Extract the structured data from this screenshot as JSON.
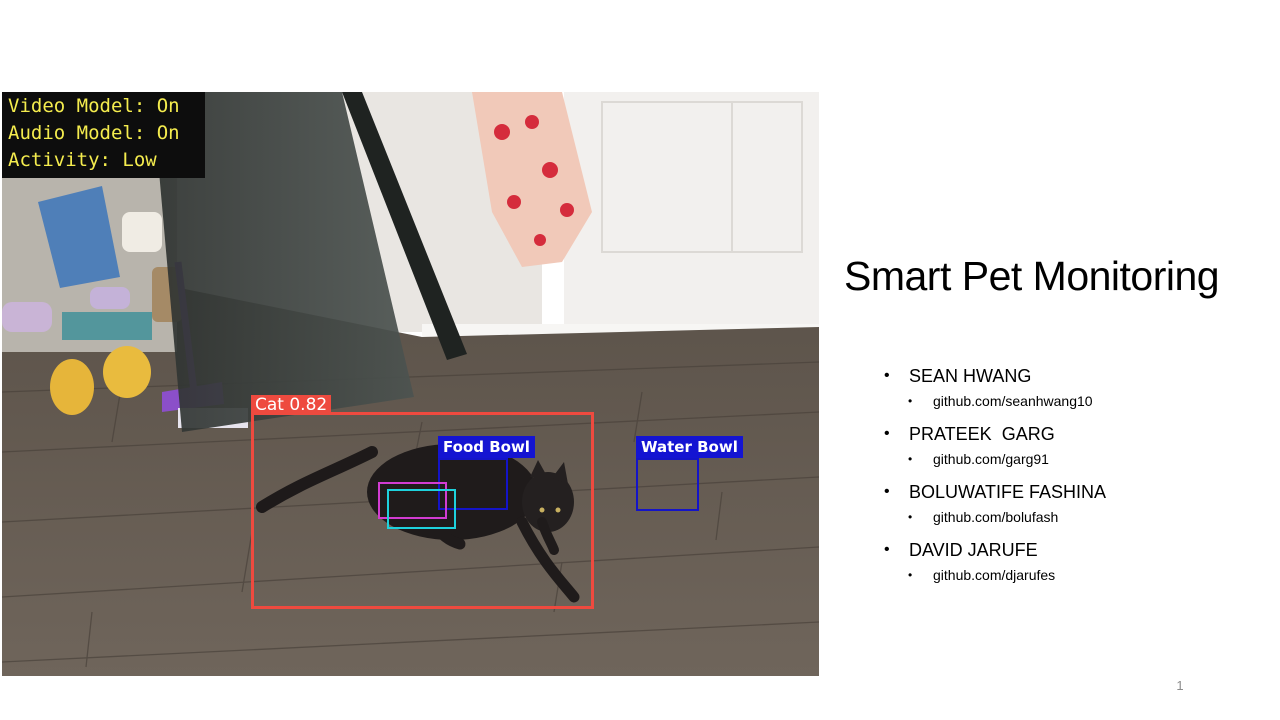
{
  "slide": {
    "title": "Smart Pet Monitoring",
    "page_number": "1",
    "team": [
      {
        "name": "SEAN HWANG",
        "link": "github.com/seanhwang10"
      },
      {
        "name": "PRATEEK  GARG",
        "link": "github.com/garg91"
      },
      {
        "name": "BOLUWATIFE FASHINA",
        "link": "github.com/bolufash"
      },
      {
        "name": "DAVID JARUFE",
        "link": "github.com/djarufes"
      }
    ]
  },
  "video": {
    "status_lines": [
      "Video Model: On",
      "Audio Model: On",
      "Activity: Low"
    ],
    "detections": {
      "cat": "Cat 0.82",
      "food_bowl": "Food Bowl",
      "water_bowl": "Water Bowl"
    }
  },
  "colors": {
    "status_text": "#f4ec4e",
    "cat_box": "#ee4a3f",
    "bowl_box": "#1414d2",
    "pink_box": "#d23cd2",
    "cyan_box": "#1ed2dc"
  },
  "icons": {
    "bullet": "•"
  }
}
